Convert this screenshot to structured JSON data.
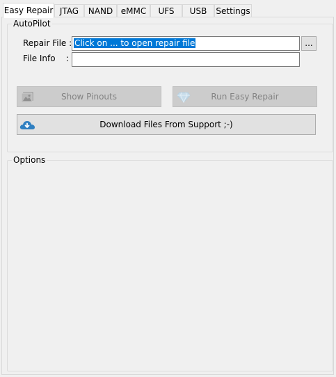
{
  "tabs": [
    {
      "label": "Easy Repair",
      "active": true
    },
    {
      "label": "JTAG"
    },
    {
      "label": "NAND"
    },
    {
      "label": "eMMC"
    },
    {
      "label": "UFS"
    },
    {
      "label": "USB"
    },
    {
      "label": "Settings"
    }
  ],
  "autopilot": {
    "title": "AutoPilot",
    "repair_file_label": "Repair File :",
    "repair_file_value": "Click on ... to open repair file",
    "file_info_label": "File Info    :",
    "file_info_value": "",
    "browse_label": "...",
    "show_pinouts_label": "Show Pinouts",
    "run_easy_repair_label": "Run Easy Repair",
    "download_label": "Download Files From Support ;-)",
    "icons": {
      "show_pinouts": "image-icon",
      "run_easy_repair": "diamond-icon",
      "download": "cloud-download-icon"
    }
  },
  "options": {
    "title": "Options"
  },
  "colors": {
    "selection": "#0078d7",
    "download_icon": "#2f7fc1",
    "disabled_text": "#838383"
  }
}
